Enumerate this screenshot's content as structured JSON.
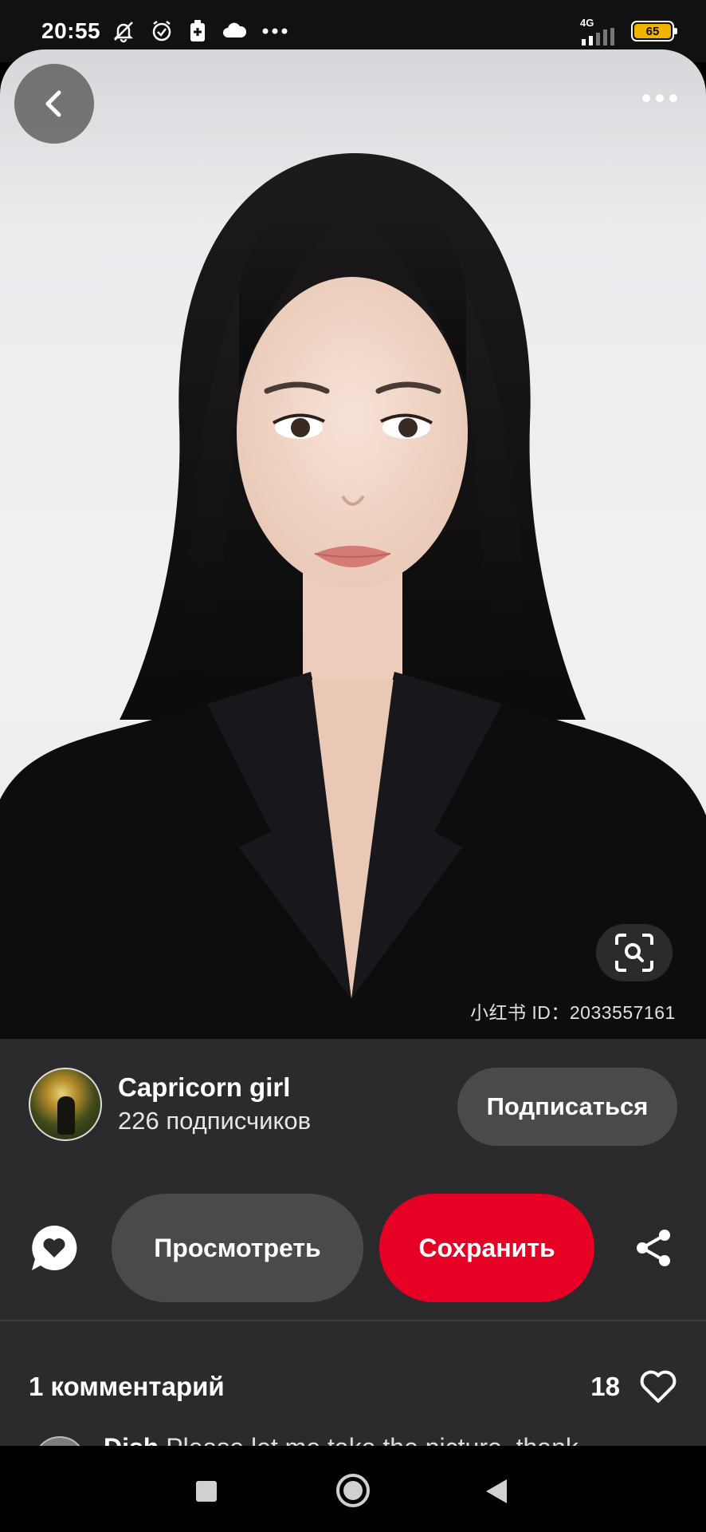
{
  "status_bar": {
    "time": "20:55",
    "network": "4G",
    "battery": "65",
    "battery_color": "#f0b400"
  },
  "top_bar": {
    "back_icon": "chevron-left-icon",
    "more_icon": "more-horizontal-icon"
  },
  "image": {
    "watermark": "小红书 ID：2033557161",
    "lens_icon": "visual-search-icon"
  },
  "author": {
    "name": "Capricorn girl",
    "subscribers": "226 подписчиков",
    "follow_label": "Подписаться"
  },
  "actions": {
    "view_label": "Просмотреть",
    "save_label": "Сохранить",
    "save_color": "#e60023"
  },
  "comments": {
    "title": "1 комментарий",
    "likes": "18",
    "first_author": "Dish",
    "first_text": "Please let me take the picture, thank"
  }
}
